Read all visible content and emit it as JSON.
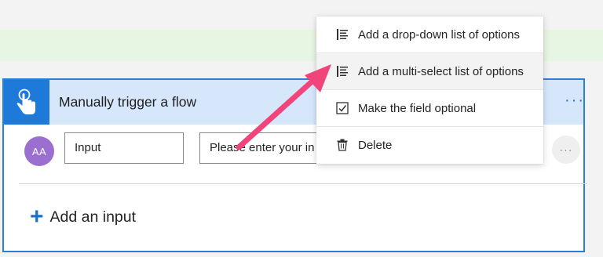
{
  "card": {
    "title": "Manually trigger a flow",
    "more_glyph": "···",
    "avatar_text": "AA",
    "input_name_value": "Input",
    "input_hint_value": "Please enter your in",
    "row_more_glyph": "···",
    "add_input_plus": "+",
    "add_input_label": "Add an input"
  },
  "menu": {
    "items": [
      {
        "label": "Add a drop-down list of options",
        "icon": "list-icon"
      },
      {
        "label": "Add a multi-select list of options",
        "icon": "list-icon"
      },
      {
        "label": "Make the field optional",
        "icon": "checkbox-icon"
      },
      {
        "label": "Delete",
        "icon": "trash-icon"
      }
    ]
  },
  "colors": {
    "accent": "#1d7ad8",
    "header_bg": "#d6e7fb",
    "arrow": "#f0447a",
    "avatar": "#9b6fcf",
    "green_strip": "#e6f6e2"
  }
}
